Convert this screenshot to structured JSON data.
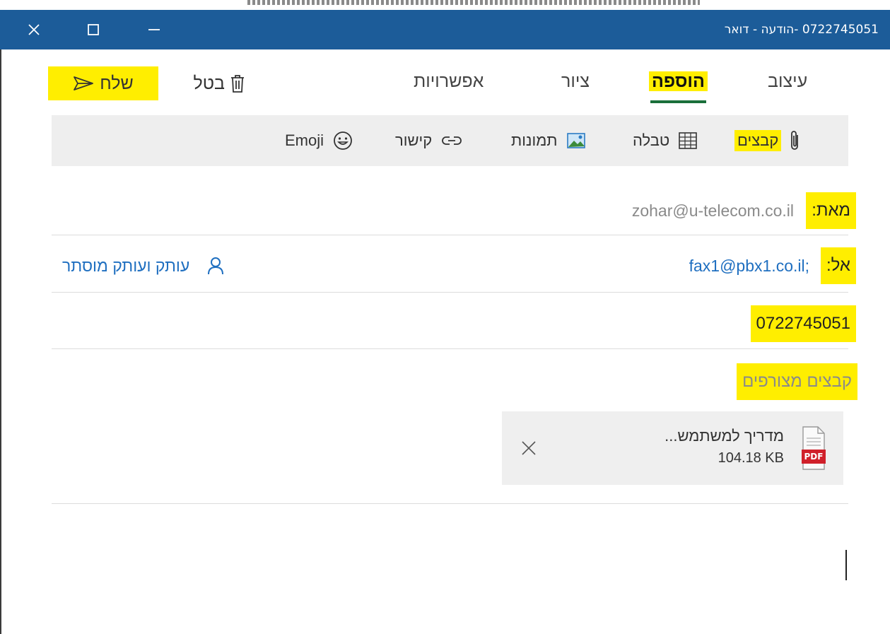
{
  "window": {
    "title": "0722745051 -הודעה - דואר",
    "controls": {
      "close_icon": "close-icon",
      "maximize_icon": "maximize-icon",
      "minimize_icon": "minimize-icon"
    }
  },
  "ribbon": {
    "tabs": [
      {
        "label": "עיצוב",
        "active": false
      },
      {
        "label": "הוספה",
        "active": true
      },
      {
        "label": "ציור",
        "active": false
      },
      {
        "label": "אפשרויות",
        "active": false
      }
    ],
    "discard_label": "בטל",
    "send_label": "שלח"
  },
  "toolbar": {
    "files_label": "קבצים",
    "table_label": "טבלה",
    "pictures_label": "תמונות",
    "link_label": "קישור",
    "emoji_label": "Emoji"
  },
  "compose": {
    "from_label": "מאת:",
    "from_value": "zohar@u-telecom.co.il",
    "to_label": "אל:",
    "to_value": "fax1@pbx1.co.il;",
    "cc_bcc_label": "עותק ועותק מוסתר",
    "subject_value": "0722745051",
    "attachments_label": "קבצים מצורפים"
  },
  "attachment": {
    "name": "מדריך למשתמש...",
    "size": "104.18 KB",
    "badge": "PDF"
  },
  "colors": {
    "titlebar": "#1c5c99",
    "highlight": "#ffee00",
    "link": "#1f6fc0",
    "active_tab_underline": "#1a6f3a",
    "pdf_red": "#d0202a"
  }
}
